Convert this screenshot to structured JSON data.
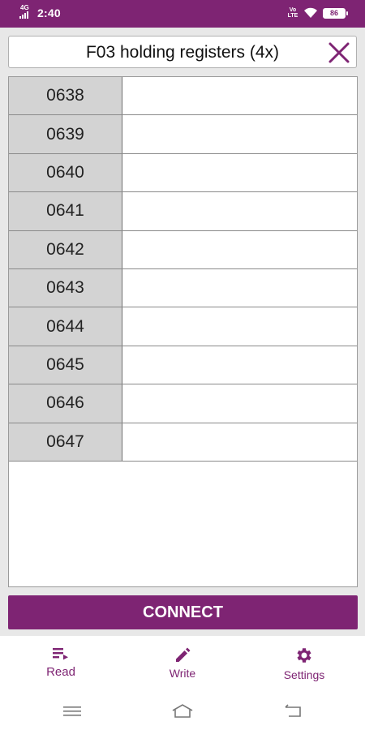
{
  "status": {
    "network": "4G",
    "time": "2:40",
    "volte": "Vo LTE",
    "battery": "86"
  },
  "header": {
    "title": "F03 holding registers (4x)"
  },
  "registers": [
    {
      "address": "0638",
      "value": ""
    },
    {
      "address": "0639",
      "value": ""
    },
    {
      "address": "0640",
      "value": ""
    },
    {
      "address": "0641",
      "value": ""
    },
    {
      "address": "0642",
      "value": ""
    },
    {
      "address": "0643",
      "value": ""
    },
    {
      "address": "0644",
      "value": ""
    },
    {
      "address": "0645",
      "value": ""
    },
    {
      "address": "0646",
      "value": ""
    },
    {
      "address": "0647",
      "value": ""
    }
  ],
  "actions": {
    "connect_label": "CONNECT"
  },
  "bottom_nav": {
    "items": [
      {
        "label": "Read",
        "icon": "read-list-icon"
      },
      {
        "label": "Write",
        "icon": "pencil-icon"
      },
      {
        "label": "Settings",
        "icon": "gear-icon"
      }
    ]
  },
  "theme": {
    "accent": "#7e2473",
    "address_bg": "#d3d3d3"
  }
}
